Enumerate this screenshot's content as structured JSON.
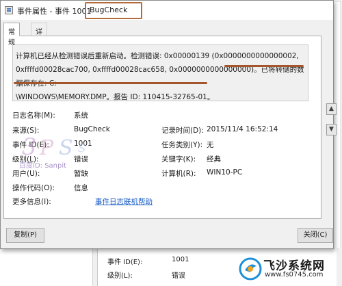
{
  "dialog": {
    "title": "事件属性 - 事件 1001",
    "title_highlight": "BugCheck"
  },
  "tabs": [
    {
      "label": "常规"
    },
    {
      "label": "详细信息"
    }
  ],
  "description": {
    "line1": "计算机已经从检测错误后重新启动。检测错误: 0x00000139 (0x0000000000000002,",
    "line2": "0xffffd00028cac700, 0xffffd00028cac658, 0x0000000000000000)。已将转储的数据保存在: C:",
    "line3": "\\WINDOWS\\MEMORY.DMP。报告 ID: 110415-32765-01。"
  },
  "fields": {
    "log_name_label": "日志名称(M):",
    "log_name_value": "系统",
    "source_label": "来源(S):",
    "source_value": "BugCheck",
    "logged_label": "记录时间(D):",
    "logged_value": "2015/11/4 16:52:14",
    "event_id_label": "事件 ID(E):",
    "event_id_value": "1001",
    "task_label": "任务类别(Y):",
    "task_value": "无",
    "level_label": "级别(L):",
    "level_value": "错误",
    "keywords_label": "关键字(K):",
    "keywords_value": "经典",
    "user_label": "用户(U):",
    "user_value": "暂缺",
    "computer_label": "计算机(R):",
    "computer_value": "WIN10-PC",
    "opcode_label": "操作代码(O):",
    "opcode_value": "信息",
    "more_info_label": "更多信息(I):",
    "more_info_link": "事件日志联机帮助"
  },
  "buttons": {
    "copy": "复制(P)",
    "close": "关闭(C)"
  },
  "background": {
    "event_id_label": "事件 ID(E):",
    "event_id_value": "1001",
    "level_label": "级别(L):",
    "level_value": "错误"
  },
  "watermark": {
    "text": "百度ID: Sanpit"
  },
  "site_logo": {
    "name": "飞沙系统网",
    "url": "www.fs0745.com"
  },
  "colors": {
    "annotation": "#a4552c",
    "link": "#1a5ec7",
    "dialog_bg": "#f0f0f0"
  }
}
